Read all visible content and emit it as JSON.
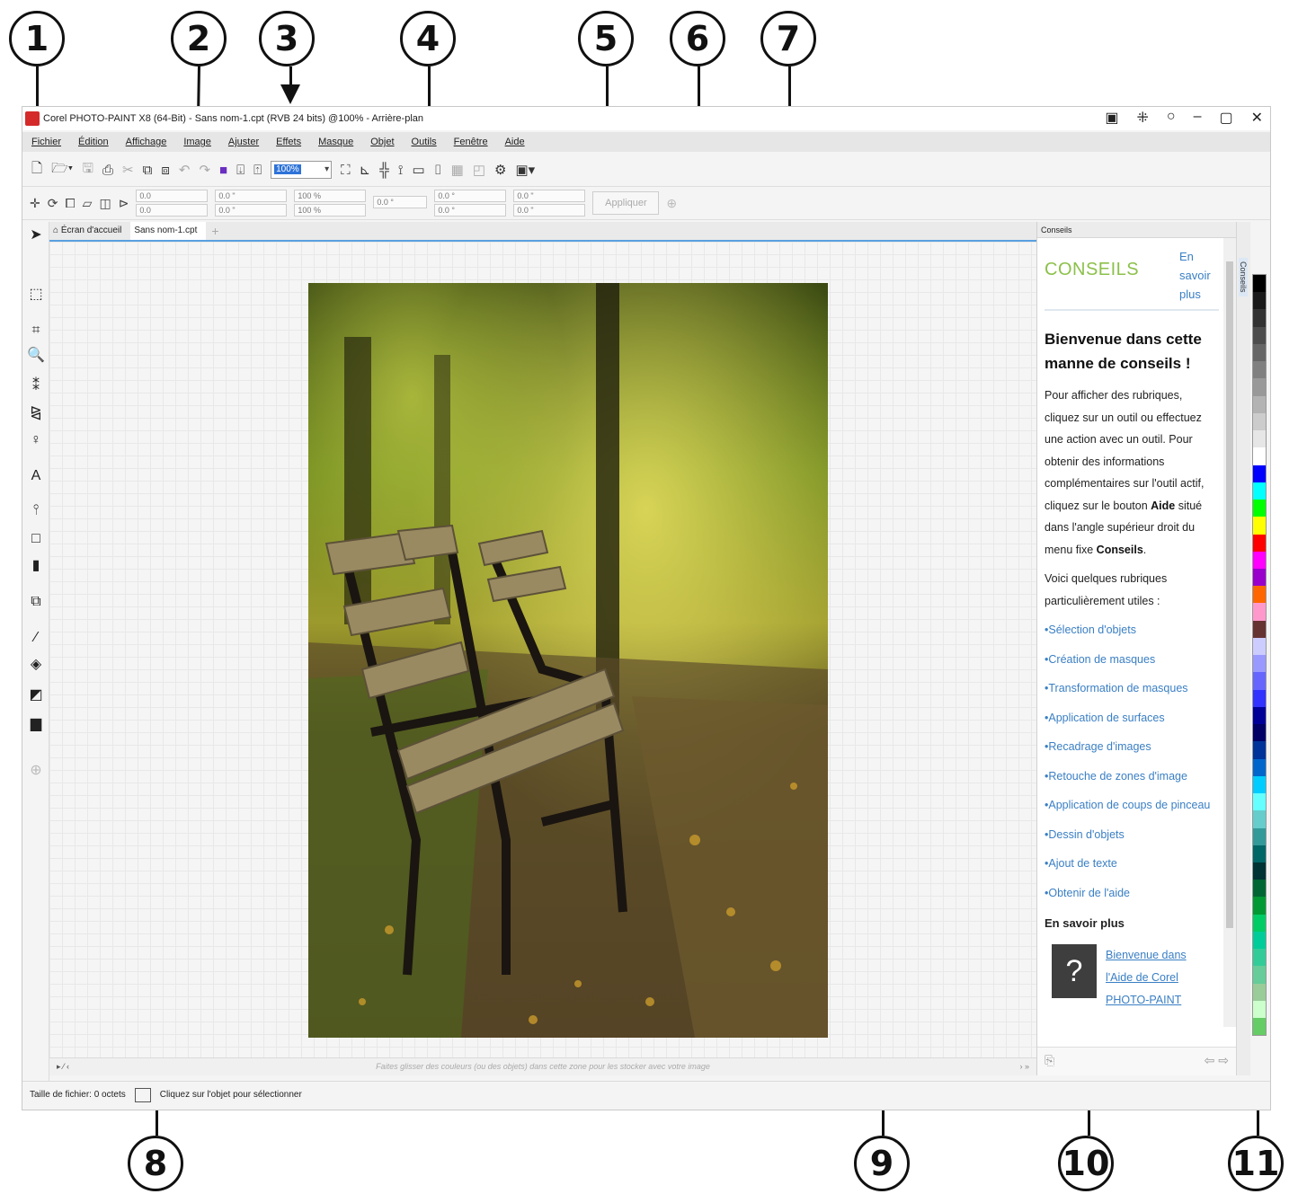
{
  "window": {
    "title": "Corel PHOTO-PAINT X8 (64-Bit) - Sans nom-1.cpt (RVB 24 bits) @100% - Arrière-plan",
    "controls": [
      "▣",
      "⁜",
      "○",
      "–",
      "▢",
      "✕"
    ]
  },
  "menu": [
    "Fichier",
    "Édition",
    "Affichage",
    "Image",
    "Ajuster",
    "Effets",
    "Masque",
    "Objet",
    "Outils",
    "Fenêtre",
    "Aide"
  ],
  "toolbar": {
    "zoom_value": "100%"
  },
  "propbar": {
    "x_value": "0.0",
    "y_value": "0.0",
    "w_value": "0.0 \"",
    "h_value": "0.0 \"",
    "sx_value": "100 %",
    "sy_value": "100 %",
    "angle_value": "0.0 °",
    "skew1_value": "0.0 °",
    "skew2_value": "0.0 °",
    "px_value": "0.0 \"",
    "py_value": "0.0 \"",
    "apply_label": "Appliquer"
  },
  "tabs": {
    "home": "Écran d'accueil",
    "document": "Sans nom-1.cpt"
  },
  "color_tray": {
    "hint": "Faites glisser des couleurs (ou des objets) dans cette zone pour les stocker avec votre image"
  },
  "status": {
    "file_size": "Taille de fichier: 0 octets",
    "hint": "Cliquez sur l'objet pour sélectionner"
  },
  "docker": {
    "header": "Conseils",
    "side_tab": "Conseils",
    "title": "CONSEILS",
    "more_link": "En savoir plus",
    "welcome": "Bienvenue dans cette manne de conseils !",
    "intro_1": "Pour afficher des rubriques, cliquez sur un outil ou effectuez une action avec un outil. Pour obtenir des informations complémentaires sur l'outil actif, cliquez sur le bouton ",
    "intro_aide": "Aide",
    "intro_2": " situé dans l'angle supérieur droit du menu fixe ",
    "intro_conseils": "Conseils",
    "intro_3": ".",
    "topics_intro": "Voici quelques rubriques particulièrement utiles :",
    "topics": [
      "•Sélection d'objets",
      "•Création de masques",
      "•Transformation de masques",
      "•Application de surfaces",
      "•Recadrage d'images",
      "•Retouche de zones d'image",
      "•Application de coups de pinceau",
      "•Dessin d'objets",
      "•Ajout de texte",
      "•Obtenir de l'aide"
    ],
    "subheading": "En savoir plus",
    "help_link": "Bienvenue dans l'Aide de Corel PHOTO-PAINT"
  },
  "palette_colors": [
    "#000000",
    "#1a1a1a",
    "#333333",
    "#4d4d4d",
    "#666666",
    "#808080",
    "#999999",
    "#b3b3b3",
    "#cccccc",
    "#e6e6e6",
    "#ffffff",
    "#0000ff",
    "#00ffff",
    "#00ff00",
    "#ffff00",
    "#ff0000",
    "#ff00ff",
    "#9900cc",
    "#ff6600",
    "#ff99cc",
    "#663333",
    "#ccccff",
    "#9999ff",
    "#6666ff",
    "#3333ff",
    "#000099",
    "#000066",
    "#003399",
    "#0066cc",
    "#00ccff",
    "#66ffff",
    "#66cccc",
    "#339999",
    "#006666",
    "#003333",
    "#006633",
    "#009933",
    "#00cc66",
    "#00cc99",
    "#33cc99",
    "#66cc99",
    "#99cc99",
    "#ccffcc",
    "#66cc66"
  ],
  "callouts": [
    "1",
    "2",
    "3",
    "4",
    "5",
    "6",
    "7",
    "8",
    "9",
    "10",
    "11"
  ]
}
